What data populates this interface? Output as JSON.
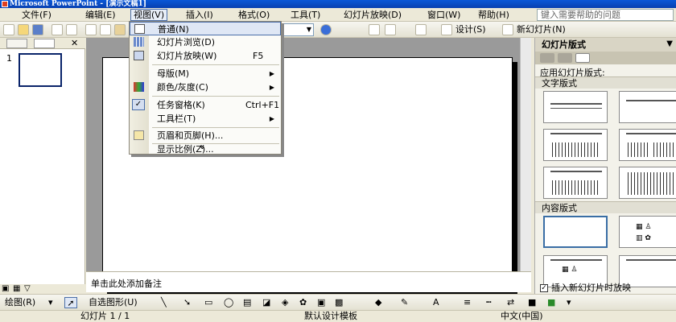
{
  "window": {
    "title": "Microsoft PowerPoint - [演示文稿1]"
  },
  "menubar": {
    "items": [
      {
        "label": "文件(F)"
      },
      {
        "label": "编辑(E)"
      },
      {
        "label": "视图(V)"
      },
      {
        "label": "插入(I)"
      },
      {
        "label": "格式(O)"
      },
      {
        "label": "工具(T)"
      },
      {
        "label": "幻灯片放映(D)"
      },
      {
        "label": "窗口(W)"
      },
      {
        "label": "帮助(H)"
      }
    ],
    "help_placeholder": "键入需要帮助的问题"
  },
  "toolbar": {
    "design_label": "设计(S)",
    "new_slide_label": "新幻灯片(N)"
  },
  "view_menu": {
    "items": [
      {
        "label": "普通(N)",
        "shortcut": ""
      },
      {
        "label": "幻灯片浏览(D)",
        "shortcut": ""
      },
      {
        "label": "幻灯片放映(W)",
        "shortcut": "F5"
      },
      {
        "label": "母版(M)",
        "shortcut": ""
      },
      {
        "label": "颜色/灰度(C)",
        "shortcut": ""
      },
      {
        "label": "任务窗格(K)",
        "shortcut": "Ctrl+F1"
      },
      {
        "label": "工具栏(T)",
        "shortcut": ""
      },
      {
        "label": "页眉和页脚(H)...",
        "shortcut": ""
      },
      {
        "label": "显示比例(Z)...",
        "shortcut": ""
      }
    ],
    "expand_glyph": "»"
  },
  "slides_pane": {
    "slide_number": "1"
  },
  "notes": {
    "placeholder": "单击此处添加备注"
  },
  "task_pane": {
    "title": "幻灯片版式",
    "apply_label": "应用幻灯片版式:",
    "section_text": "文字版式",
    "section_content": "内容版式",
    "checkbox_label": "插入新幻灯片时放映",
    "checkbox_checked": true
  },
  "drawbar": {
    "draw_label": "绘图(R)",
    "autoshapes_label": "自选图形(U)"
  },
  "statusbar": {
    "slide": "幻灯片 1 / 1",
    "design": "默认设计模板",
    "language": "中文(中国)"
  }
}
